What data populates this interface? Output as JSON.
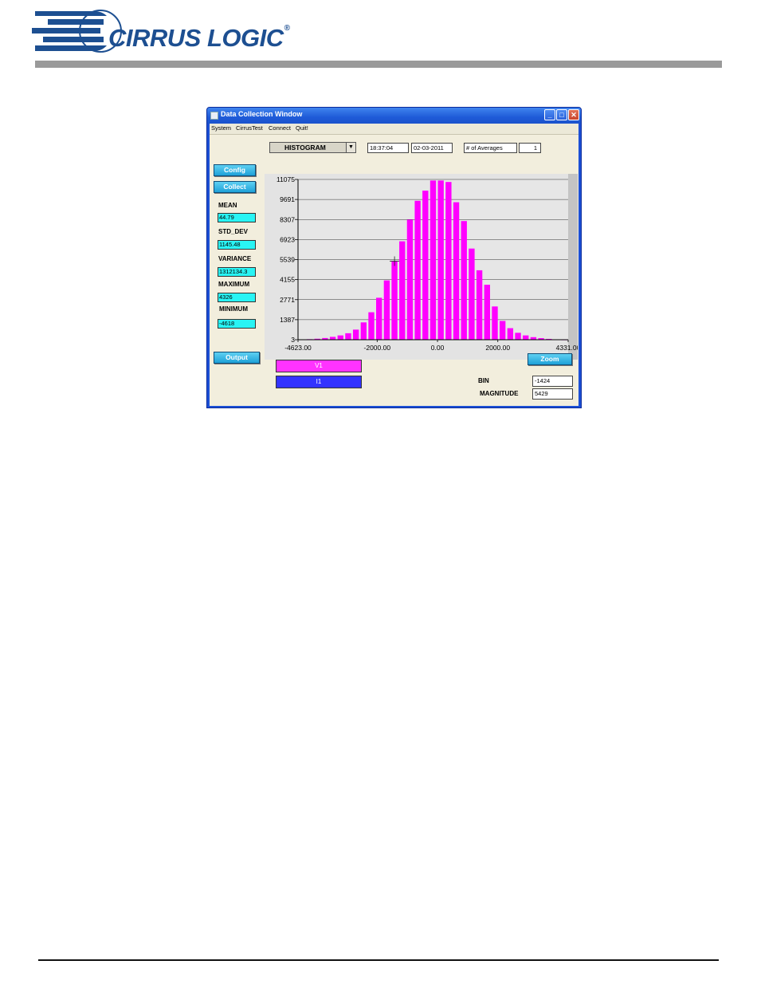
{
  "brand": {
    "name": "CIRRUS LOGIC",
    "registered": "®"
  },
  "window": {
    "title": "Data Collection Window",
    "controls": {
      "minimize": "_",
      "maximize": "□",
      "close": "✕"
    },
    "menu": [
      "System",
      "CirrusTest",
      "Connect",
      "Quit!"
    ]
  },
  "toolbar": {
    "mode": "HISTOGRAM",
    "time": "18:37:04",
    "date": "02-03-2011",
    "averages_label": "# of Averages",
    "averages_value": "1"
  },
  "buttons": {
    "config": "Config",
    "collect": "Collect",
    "output": "Output",
    "zoom": "Zoom"
  },
  "stats": [
    {
      "label": "MEAN",
      "value": "44.79"
    },
    {
      "label": "STD_DEV",
      "value": "1145.48"
    },
    {
      "label": "VARIANCE",
      "value": "1312134.3"
    },
    {
      "label": "MAXIMUM",
      "value": "4326"
    },
    {
      "label": "MINIMUM",
      "value": "-4618"
    }
  ],
  "series_buttons": [
    {
      "label": "V1",
      "color": "#ff33ff"
    },
    {
      "label": "I1",
      "color": "#3333ff"
    }
  ],
  "readout": {
    "bin_label": "BIN",
    "bin_value": "-1424",
    "magnitude_label": "MAGNITUDE",
    "magnitude_value": "5429"
  },
  "colors": {
    "bars": "#ff00ff",
    "plot_bg": "#e6e6e6",
    "cyan_field": "#29f4f4",
    "button": "#1fa1d8"
  },
  "chart_data": {
    "type": "bar",
    "x_ticks": [
      "-4623.00",
      "-2000.00",
      "0.00",
      "2000.00",
      "4331.00"
    ],
    "x_tick_values": [
      -4623,
      -2000,
      0,
      2000,
      4331
    ],
    "y_ticks": [
      "11075",
      "9691",
      "8307",
      "6923",
      "5539",
      "4155",
      "2771",
      "1387",
      "3"
    ],
    "y_tick_values": [
      11075,
      9691,
      8307,
      6923,
      5539,
      4155,
      2771,
      1387,
      3
    ],
    "xlim": [
      -4623,
      4331
    ],
    "ylim": [
      3,
      11075
    ],
    "grid": true,
    "bins": [
      -4500,
      -4250,
      -4000,
      -3750,
      -3500,
      -3250,
      -3000,
      -2750,
      -2500,
      -2250,
      -2000,
      -1750,
      -1500,
      -1250,
      -1000,
      -750,
      -500,
      -250,
      0,
      250,
      500,
      750,
      1000,
      1250,
      1500,
      1750,
      2000,
      2250,
      2500,
      2750,
      3000,
      3250,
      3500,
      3750,
      4000
    ],
    "values": [
      20,
      40,
      70,
      120,
      200,
      300,
      450,
      700,
      1200,
      1900,
      2900,
      4100,
      5429,
      6800,
      8300,
      9600,
      10300,
      11000,
      11000,
      10900,
      9500,
      8200,
      6300,
      4800,
      3800,
      2300,
      1300,
      800,
      480,
      300,
      180,
      110,
      60,
      30,
      15
    ],
    "cursor": {
      "x": -1424,
      "y": 5429
    }
  }
}
